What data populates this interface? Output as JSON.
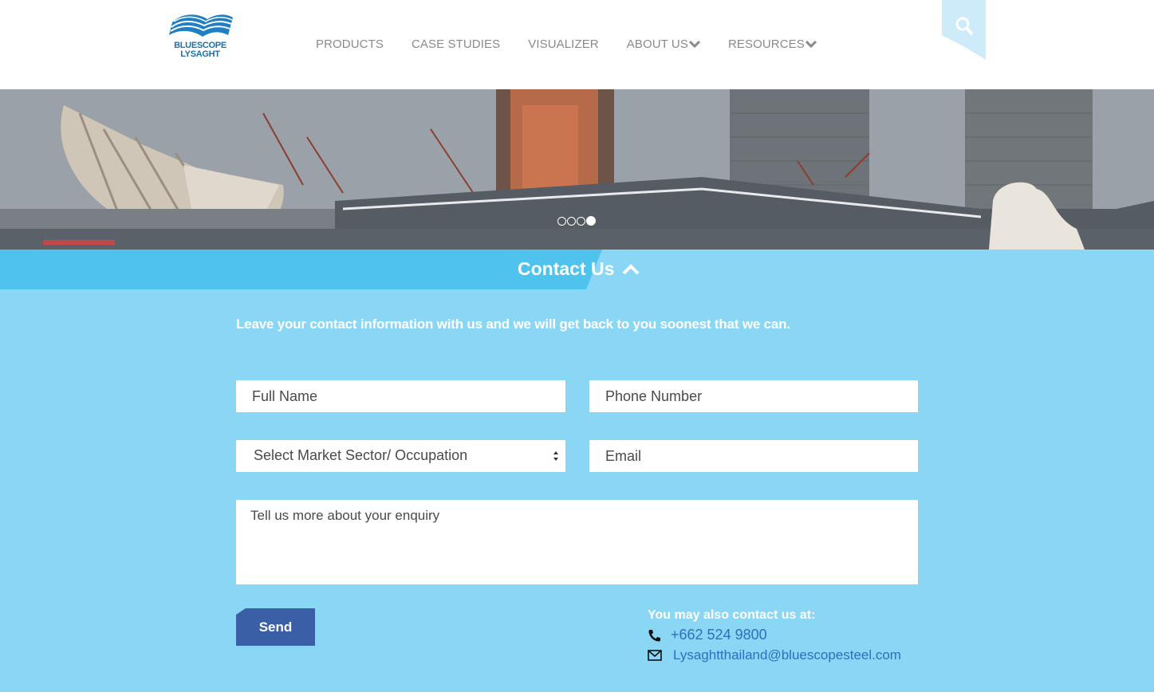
{
  "brand": {
    "logo_line1": "BLUESCOPE",
    "logo_line2": "LYSAGHT",
    "color_primary": "#1f6fa8",
    "color_light": "#8ad6f5",
    "color_bar": "#4fc3ee",
    "color_button": "#3b5fa6"
  },
  "nav": {
    "items": [
      {
        "label": "PRODUCTS",
        "has_dropdown": false
      },
      {
        "label": "CASE STUDIES",
        "has_dropdown": false
      },
      {
        "label": "VISUALIZER",
        "has_dropdown": false
      },
      {
        "label": "ABOUT US",
        "has_dropdown": true
      },
      {
        "label": "RESOURCES",
        "has_dropdown": true
      }
    ],
    "search_icon": "search-icon"
  },
  "hero": {
    "slides_total": 4,
    "active_slide": 4
  },
  "contact": {
    "title": "Contact Us",
    "intro": "Leave your contact information with us and we will get back to you soonest that we can.",
    "form": {
      "full_name_placeholder": "Full Name",
      "phone_placeholder": "Phone Number",
      "sector_selected": "Select Market Sector/ Occupation",
      "email_placeholder": "Email",
      "enquiry_placeholder": "Tell us more about your enquiry",
      "send_label": "Send"
    },
    "also_label": "You may also contact us at:",
    "phone": "+662 524 9800",
    "email": "Lysaghtthailand@bluescopesteel.com"
  }
}
